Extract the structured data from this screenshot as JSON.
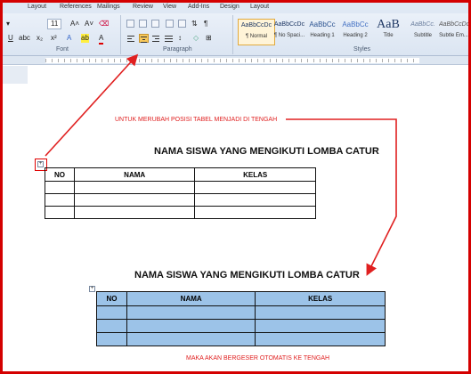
{
  "ribbon": {
    "tabs": [
      "Layout",
      "References",
      "Mailings",
      "Review",
      "View",
      "Add-Ins",
      "Design",
      "Layout"
    ],
    "font_size": "11",
    "groups": {
      "font": "Font",
      "paragraph": "Paragraph",
      "styles": "Styles"
    },
    "styles": [
      {
        "preview": "AaBbCcDc",
        "name": "¶ Normal"
      },
      {
        "preview": "AaBbCcDc",
        "name": "¶ No Spaci..."
      },
      {
        "preview": "AaBbCc",
        "name": "Heading 1"
      },
      {
        "preview": "AaBbCc",
        "name": "Heading 2"
      },
      {
        "preview": "AaB",
        "name": "Title"
      },
      {
        "preview": "AaBbCc.",
        "name": "Subtitle"
      },
      {
        "preview": "AaBbCcDc",
        "name": "Subtle Em..."
      }
    ]
  },
  "annotations": {
    "top": "UNTUK MERUBAH POSISI TABEL MENJADI DI TENGAH",
    "bottom": "MAKA AKAN BERGESER OTOMATIS KE TENGAH"
  },
  "table_before": {
    "title": "NAMA SISWA YANG MENGIKUTI LOMBA CATUR",
    "headers": [
      "NO",
      "NAMA",
      "KELAS"
    ]
  },
  "table_after": {
    "title": "NAMA SISWA YANG MENGIKUTI LOMBA CATUR",
    "headers": [
      "NO",
      "NAMA",
      "KELAS"
    ]
  },
  "colors": {
    "arrow": "#e02020",
    "selection": "#9cc3e8",
    "highlight_button": "#f7c85a"
  }
}
